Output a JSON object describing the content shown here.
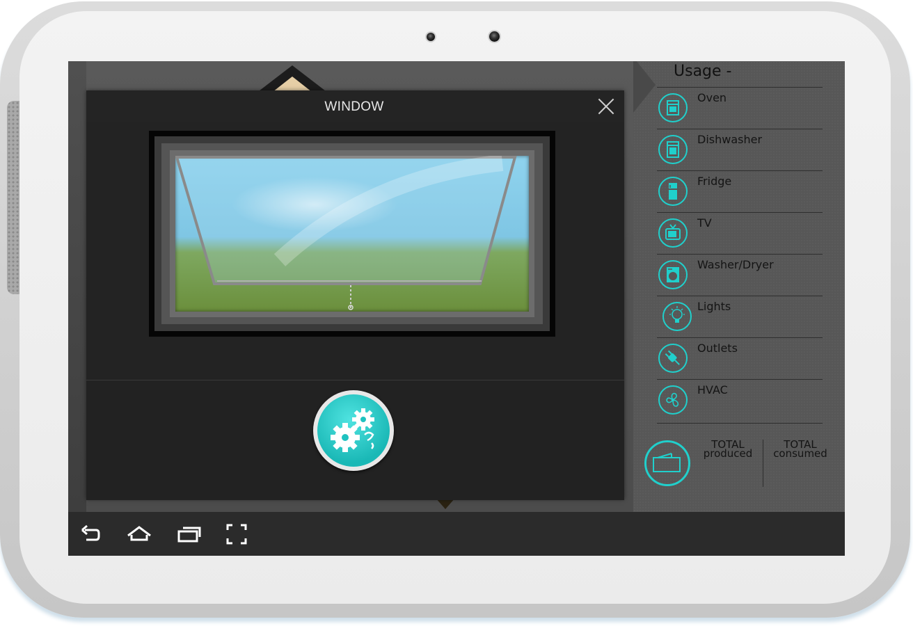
{
  "modal": {
    "title": "WINDOW",
    "close_icon": "close-icon",
    "action_icon": "gears-icon"
  },
  "panel": {
    "title": "Usage -",
    "items": [
      {
        "label": "Oven",
        "icon": "oven-icon"
      },
      {
        "label": "Dishwasher",
        "icon": "dishwasher-icon"
      },
      {
        "label": "Fridge",
        "icon": "fridge-icon"
      },
      {
        "label": "TV",
        "icon": "tv-icon"
      },
      {
        "label": "Washer/Dryer",
        "icon": "washer-icon"
      },
      {
        "label": "Lights",
        "icon": "lightbulb-icon"
      },
      {
        "label": "Outlets",
        "icon": "plug-icon"
      },
      {
        "label": "HVAC",
        "icon": "fan-icon"
      }
    ],
    "totals": {
      "produced_line1": "TOTAL",
      "produced_line2": "produced",
      "consumed_line1": "TOTAL",
      "consumed_line2": "consumed"
    }
  },
  "navbar": {
    "buttons": [
      "back-icon",
      "home-icon",
      "recent-apps-icon",
      "fullscreen-icon"
    ]
  },
  "colors": {
    "accent": "#20d0cc",
    "panel_bg": "#575757",
    "modal_bg": "#242424",
    "navbar_bg": "#2b2b2b",
    "device_frame": "#d4d4d4"
  }
}
